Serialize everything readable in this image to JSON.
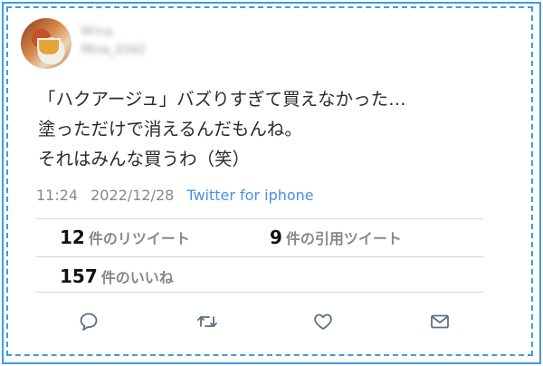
{
  "user": {
    "name": "Mina",
    "handle": "Mina_0342"
  },
  "tweet": {
    "lines": [
      "「ハクアージュ」バズりすぎて買えなかった…",
      "塗っただけで消えるんだもんね。",
      "それはみんな買うわ（笑）"
    ],
    "time": "11:24",
    "date": "2022/12/28",
    "source": "Twitter for iphone"
  },
  "stats": {
    "retweets": {
      "count": "12",
      "label": "件のリツイート"
    },
    "quotes": {
      "count": "9",
      "label": "件の引用ツイート"
    },
    "likes": {
      "count": "157",
      "label": "件のいいね"
    }
  },
  "icons": [
    "reply-icon",
    "retweet-icon",
    "like-icon",
    "share-icon"
  ],
  "colors": {
    "accent": "#3d9be9",
    "link": "#4a90e2",
    "icon": "#5b7083"
  }
}
